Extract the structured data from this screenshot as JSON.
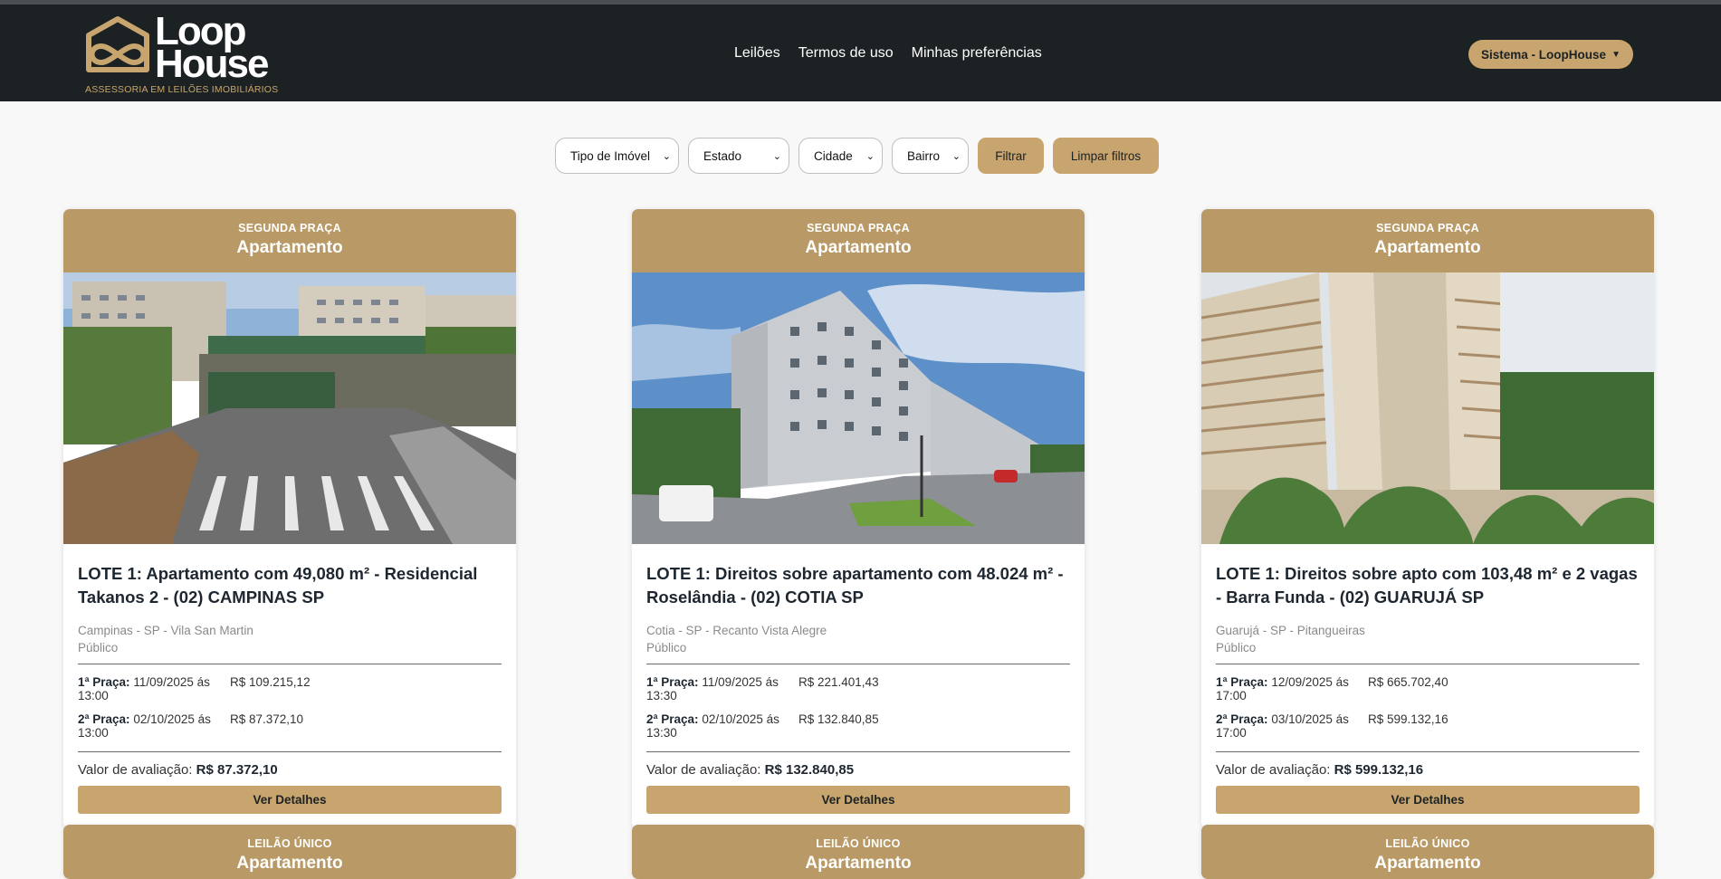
{
  "header": {
    "logo_word_1": "Loop",
    "logo_word_2": "House",
    "logo_tagline": "ASSESSORIA EM LEILÕES IMOBILIÁRIOS",
    "nav": [
      "Leilões",
      "Termos de uso",
      "Minhas preferências"
    ],
    "system_button": "Sistema - LoopHouse"
  },
  "filters": {
    "tipo": "Tipo de Imóvel",
    "estado": "Estado",
    "cidade": "Cidade",
    "bairro": "Bairro",
    "filtrar": "Filtrar",
    "limpar": "Limpar filtros"
  },
  "cards": [
    {
      "tag": "SEGUNDA PRAÇA",
      "tipo": "Apartamento",
      "title": "LOTE 1: Apartamento com 49,080 m² - Residencial Takanos 2 - (02) CAMPINAS SP",
      "location": "Campinas - SP - Vila San Martin",
      "modalidade": "Público",
      "praca1_label": "1ª Praça:",
      "praca1_date": "11/09/2025 ás 13:00",
      "praca1_value": "R$ 109.215,12",
      "praca2_label": "2ª Praça:",
      "praca2_date": "02/10/2025 ás 13:00",
      "praca2_value": "R$ 87.372,10",
      "aval_label": "Valor de avaliação:",
      "aval_value": "R$ 87.372,10",
      "button": "Ver Detalhes"
    },
    {
      "tag": "SEGUNDA PRAÇA",
      "tipo": "Apartamento",
      "title": "LOTE 1: Direitos sobre apartamento com 48.024 m² - Roselândia - (02) COTIA SP",
      "location": "Cotia - SP - Recanto Vista Alegre",
      "modalidade": "Público",
      "praca1_label": "1ª Praça:",
      "praca1_date": "11/09/2025 ás 13:30",
      "praca1_value": "R$ 221.401,43",
      "praca2_label": "2ª Praça:",
      "praca2_date": "02/10/2025 ás 13:30",
      "praca2_value": "R$ 132.840,85",
      "aval_label": "Valor de avaliação:",
      "aval_value": "R$ 132.840,85",
      "button": "Ver Detalhes"
    },
    {
      "tag": "SEGUNDA PRAÇA",
      "tipo": "Apartamento",
      "title": "LOTE 1: Direitos sobre apto com 103,48 m² e 2 vagas - Barra Funda - (02) GUARUJÁ SP",
      "location": "Guarujá - SP - Pitangueiras",
      "modalidade": "Público",
      "praca1_label": "1ª Praça:",
      "praca1_date": "12/09/2025 ás 17:00",
      "praca1_value": "R$ 665.702,40",
      "praca2_label": "2ª Praça:",
      "praca2_date": "03/10/2025 ás 17:00",
      "praca2_value": "R$ 599.132,16",
      "aval_label": "Valor de avaliação:",
      "aval_value": "R$ 599.132,16",
      "button": "Ver Detalhes"
    }
  ],
  "next_row": [
    {
      "tag": "LEILÃO ÚNICO",
      "tipo": "Apartamento"
    },
    {
      "tag": "LEILÃO ÚNICO",
      "tipo": "Apartamento"
    },
    {
      "tag": "LEILÃO ÚNICO",
      "tipo": "Apartamento"
    }
  ],
  "colors": {
    "header_bg": "#1c2124",
    "accent": "#c8a56e",
    "card_head": "#b99a66"
  }
}
